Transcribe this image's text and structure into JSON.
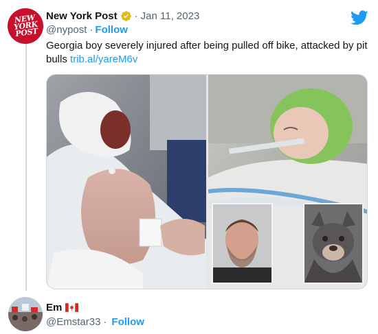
{
  "tweet": {
    "avatar_text": [
      "NEW",
      "YORK",
      "POST"
    ],
    "display_name": "New York Post",
    "separator": "·",
    "date": "Jan 11, 2023",
    "handle": "@nypost",
    "follow_sep": "·",
    "follow_label": "Follow",
    "text": "Georgia boy severely injured after being pulled off bike, attacked by pit bulls ",
    "link": "trib.al/yareM6v",
    "icons": {
      "verified": "verified-badge-icon",
      "platform": "twitter-bird-icon"
    }
  },
  "reply": {
    "display_name": "Em",
    "flag": "canada-flag-icon",
    "handle": "@Emstar33",
    "follow_sep": "·",
    "follow_label": "Follow"
  },
  "colors": {
    "brand_blue": "#1d9bf0",
    "nypost_red": "#c8102e",
    "verified_gold": "#e2b719",
    "muted_text": "#536471"
  }
}
